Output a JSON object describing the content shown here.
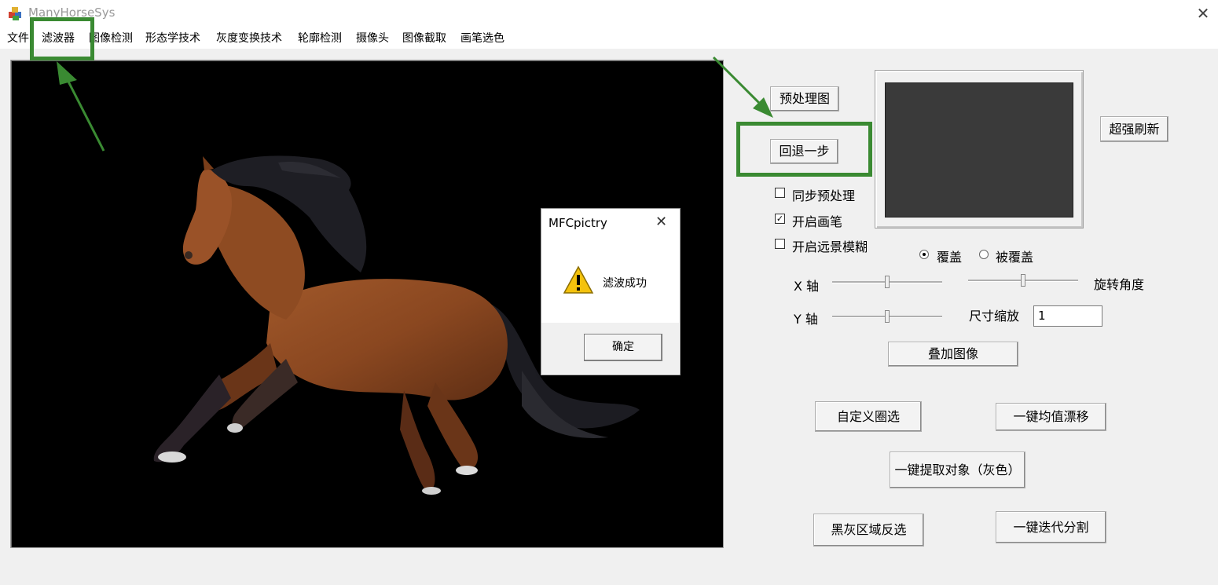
{
  "window": {
    "title": "ManyHorseSys",
    "close_glyph": "✕"
  },
  "menu": [
    "文件",
    "滤波器",
    "图像检测",
    "形态学技术",
    "灰度变换技术",
    "轮廓检测",
    "摄像头",
    "图像截取",
    "画笔选色"
  ],
  "controls": {
    "preprocess_button": "预处理图",
    "undo_button": "回退一步",
    "refresh_button": "超强刷新",
    "sync_preprocess": {
      "label": "同步预处理",
      "checked": false
    },
    "enable_brush": {
      "label": "开启画笔",
      "checked": true
    },
    "enable_blur": {
      "label": "开启远景模糊",
      "checked": false
    },
    "radio_cover": {
      "label": "覆盖",
      "selected": true
    },
    "radio_covered": {
      "label": "被覆盖",
      "selected": false
    },
    "x_axis_label": "X 轴",
    "y_axis_label": "Y 轴",
    "rotate_label": "旋转角度",
    "scale_label": "尺寸缩放",
    "scale_value": "1",
    "overlay_button": "叠加图像",
    "custom_select_button": "自定义圈选",
    "mean_shift_button": "一键均值漂移",
    "extract_gray_button": "一键提取对象（灰色）",
    "invert_select_button": "黑灰区域反选",
    "iterative_split_button": "一键迭代分割"
  },
  "dialog": {
    "title": "MFCpictry",
    "close_glyph": "✕",
    "message": "滤波成功",
    "ok_button": "确定",
    "icon": "warning-icon"
  },
  "colors": {
    "highlight": "#3a8a32"
  }
}
